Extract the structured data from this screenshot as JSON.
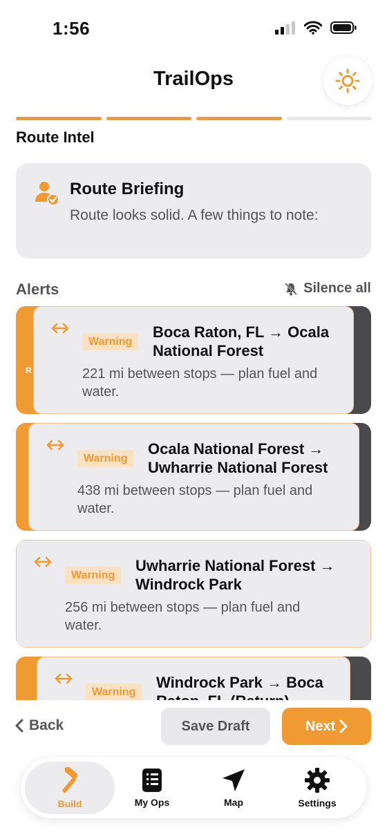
{
  "status_bar": {
    "time": "1:56"
  },
  "header": {
    "title": "TrailOps",
    "theme_icon": "sun-icon"
  },
  "progress": {
    "total_steps": 4,
    "completed_steps": 3
  },
  "section": {
    "title": "Route Intel"
  },
  "briefing": {
    "title": "Route Briefing",
    "text": "Route looks solid. A few things to note:"
  },
  "alerts": {
    "label": "Alerts",
    "silence_label": "Silence all",
    "items": [
      {
        "badge": "Warning",
        "title": "Boca Raton, FL → Ocala National Forest",
        "desc": "221 mi between stops — plan fuel and water.",
        "peek": "R"
      },
      {
        "badge": "Warning",
        "title": "Ocala National Forest → Uwharrie National Forest",
        "desc": "438 mi between stops — plan fuel and water."
      },
      {
        "badge": "Warning",
        "title": "Uwharrie National Forest → Windrock Park",
        "desc": "256 mi between stops — plan fuel and water."
      },
      {
        "badge": "Warning",
        "title": "Windrock Park → Boca Raton, FL (Return)",
        "desc": ""
      }
    ]
  },
  "actions": {
    "back": "Back",
    "save_draft": "Save Draft",
    "next": "Next"
  },
  "tabs": [
    {
      "label": "Build",
      "icon": "hammer-icon",
      "active": true
    },
    {
      "label": "My Ops",
      "icon": "notebook-icon",
      "active": false
    },
    {
      "label": "Map",
      "icon": "navigation-arrow-icon",
      "active": false
    },
    {
      "label": "Settings",
      "icon": "gear-icon",
      "active": false
    }
  ],
  "colors": {
    "accent": "#ef9a32",
    "card": "#ececee",
    "danger_swipe": "#4a4a4c",
    "badge_bg": "#f9e1c2"
  }
}
